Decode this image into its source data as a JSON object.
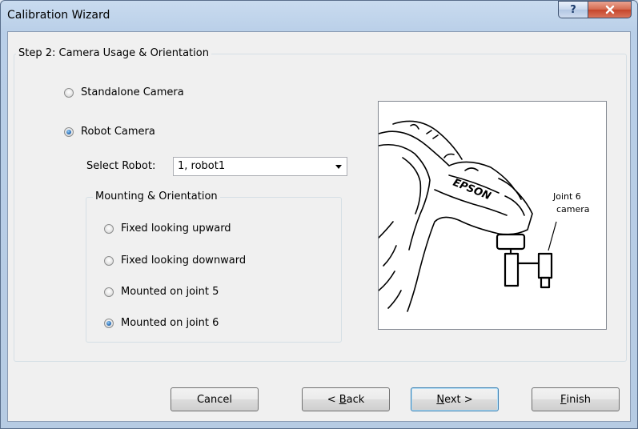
{
  "window": {
    "title": "Calibration Wizard",
    "help_glyph": "?",
    "close_glyph": "x"
  },
  "step": {
    "title": "Step 2: Camera Usage & Orientation"
  },
  "camera_usage": {
    "standalone_label": "Standalone Camera",
    "robot_label": "Robot Camera",
    "selected": "Robot Camera"
  },
  "robot_select": {
    "label": "Select Robot:",
    "value": "1, robot1"
  },
  "mounting": {
    "title": "Mounting & Orientation",
    "options": [
      "Fixed looking upward",
      "Fixed looking downward",
      "Mounted on joint 5",
      "Mounted on joint 6"
    ],
    "selected": "Mounted on joint 6"
  },
  "preview": {
    "brand": "EPSON",
    "callout_line1": "Joint 6",
    "callout_line2": "camera"
  },
  "buttons": {
    "cancel": "Cancel",
    "back_arrow": "< ",
    "back_mnemonic": "B",
    "back_rest": "ack",
    "next_mnemonic": "N",
    "next_rest": "ext >",
    "finish_mnemonic": "F",
    "finish_rest": "inish"
  },
  "colors": {
    "title_bar": "#b9cfe8",
    "close_button": "#c5452b",
    "dialog_background": "#f0f0f0",
    "default_button_border": "#3c7fb1"
  }
}
